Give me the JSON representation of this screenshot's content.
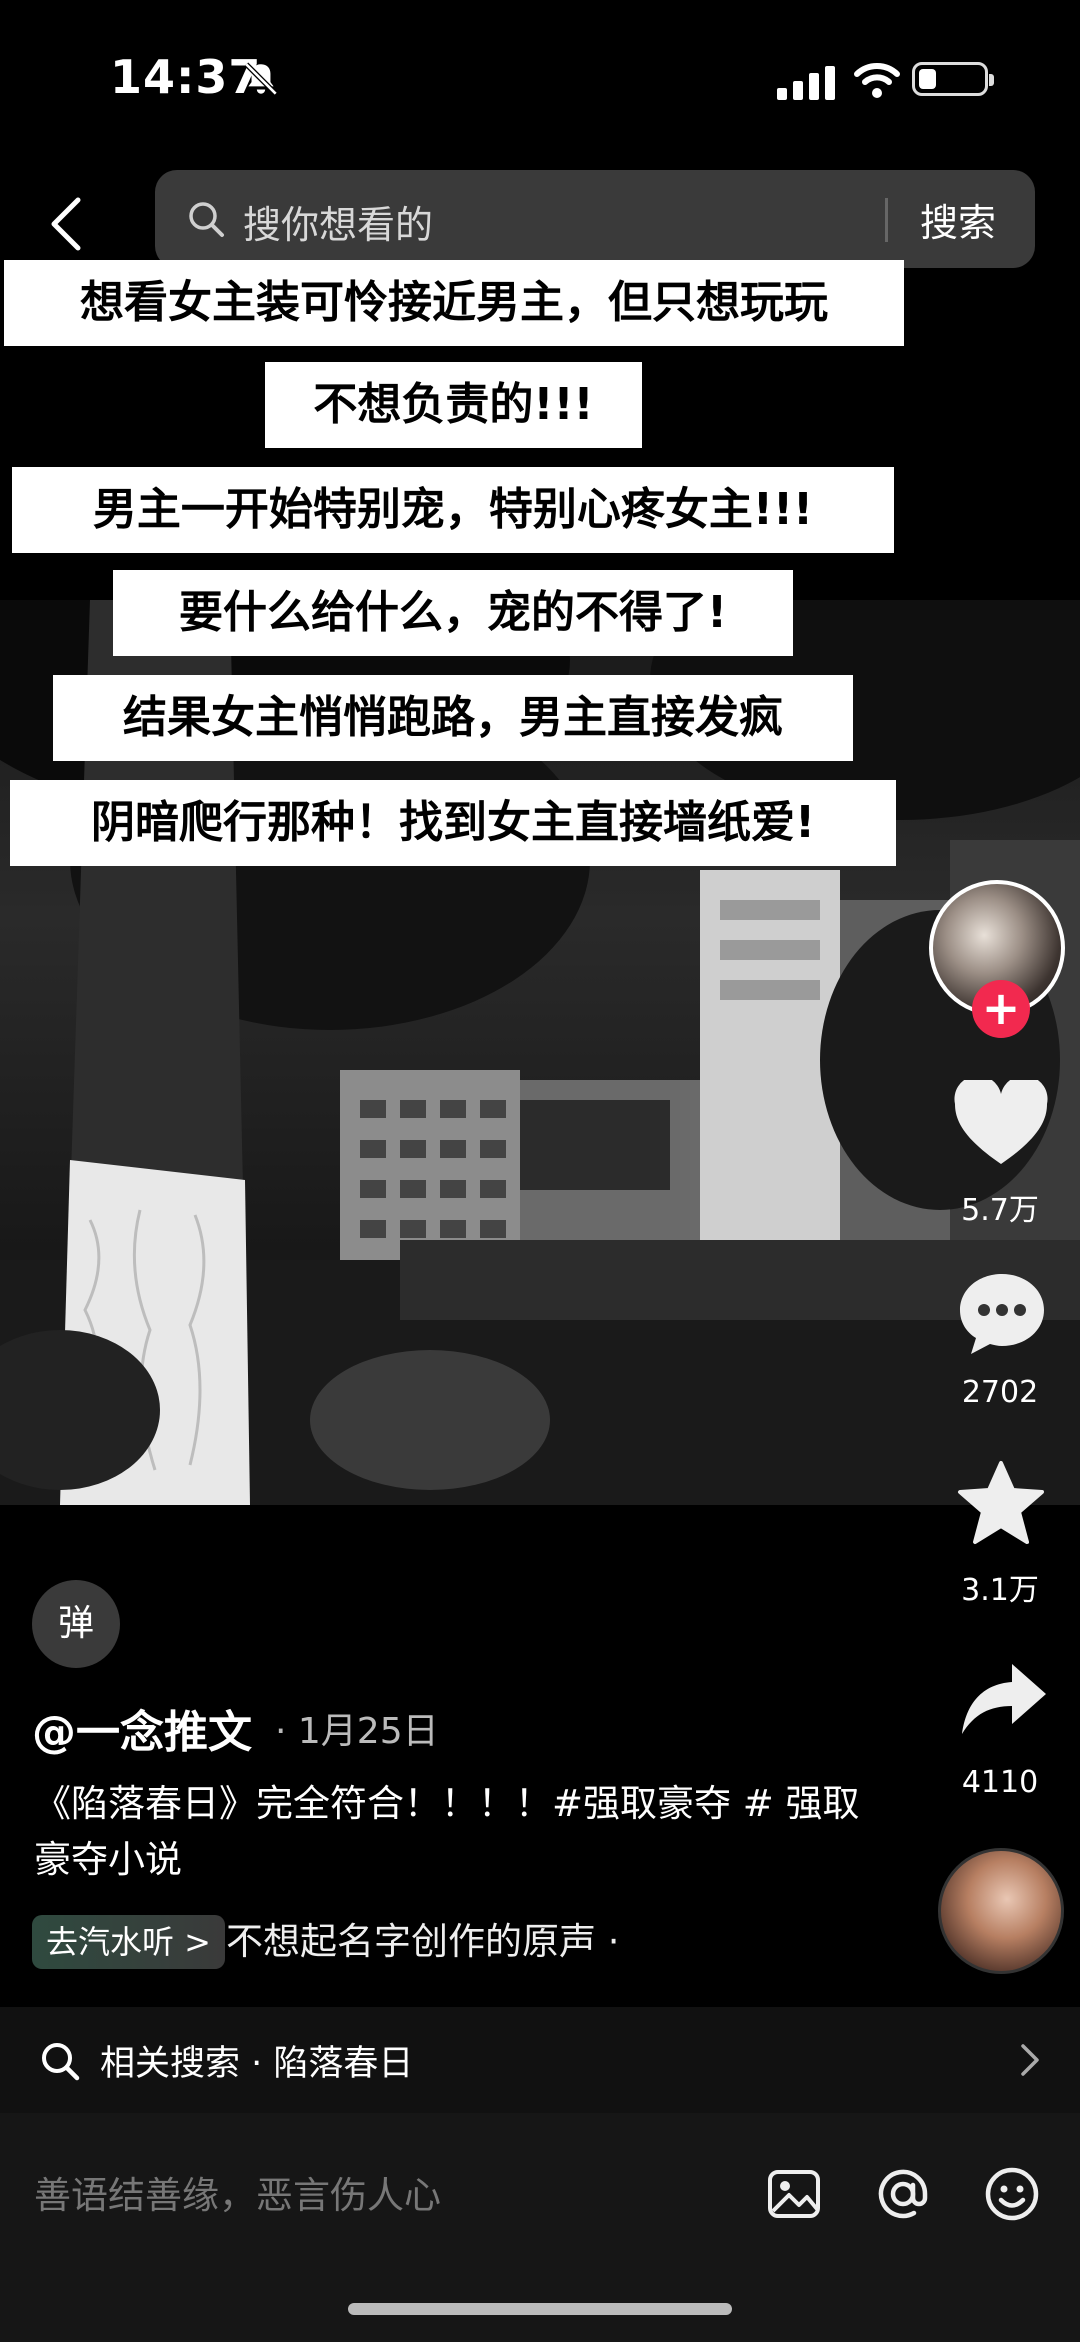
{
  "status": {
    "time": "14:37"
  },
  "search": {
    "placeholder": "搜你想看的",
    "button": "搜索"
  },
  "captions": [
    "想看女主装可怜接近男主，但只想玩玩",
    "不想负责的!!!",
    "男主一开始特别宠，特别心疼女主!!!",
    "要什么给什么，宠的不得了!",
    "结果女主悄悄跑路，男主直接发疯",
    "阴暗爬行那种！找到女主直接墙纸爱!"
  ],
  "actions": {
    "likes": "5.7万",
    "comments": "2702",
    "favorites": "3.1万",
    "shares": "4110"
  },
  "post": {
    "danmu_label": "弹",
    "author": "@一念推文",
    "date": "· 1月25日",
    "description": "《陷落春日》完全符合！！！！#强取豪夺 # 强取豪夺小说",
    "audio_button": "去汽水听 >",
    "audio_title": "不想起名字创作的原声 ·"
  },
  "related": {
    "text": "相关搜索 · 陷落春日"
  },
  "comment_input": {
    "placeholder": "善语结善缘，恶言伤人心"
  },
  "colors": {
    "follow_badge": "#f2294f"
  }
}
